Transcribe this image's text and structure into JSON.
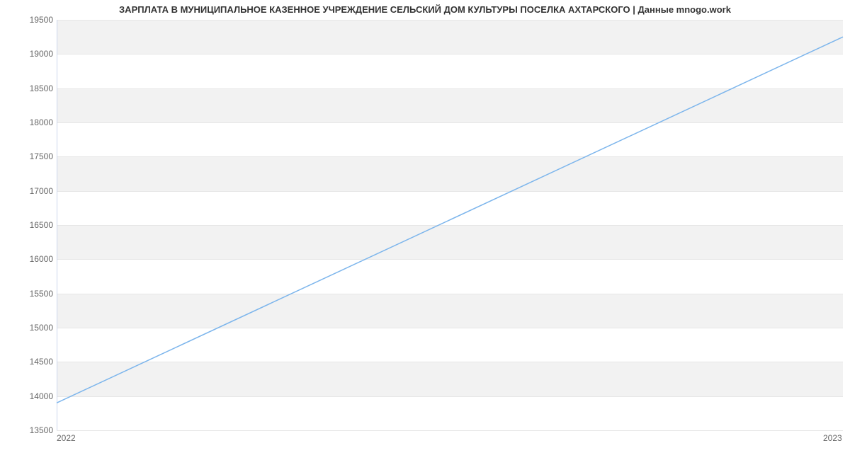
{
  "chart_data": {
    "type": "line",
    "title": "ЗАРПЛАТА В МУНИЦИПАЛЬНОЕ КАЗЕННОЕ УЧРЕЖДЕНИЕ СЕЛЬСКИЙ ДОМ КУЛЬТУРЫ ПОСЕЛКА АХТАРСКОГО | Данные mnogo.work",
    "x": [
      2022,
      2023
    ],
    "values": [
      13900,
      19250
    ],
    "xlabel": "",
    "ylabel": "",
    "xlim": [
      2022,
      2023
    ],
    "ylim": [
      13500,
      19500
    ],
    "yticks": [
      13500,
      14000,
      14500,
      15000,
      15500,
      16000,
      16500,
      17000,
      17500,
      18000,
      18500,
      19000,
      19500
    ],
    "xticks": [
      "2022",
      "2023"
    ],
    "line_color": "#7cb5ec",
    "band_color": "#f2f2f2",
    "grid": true
  }
}
